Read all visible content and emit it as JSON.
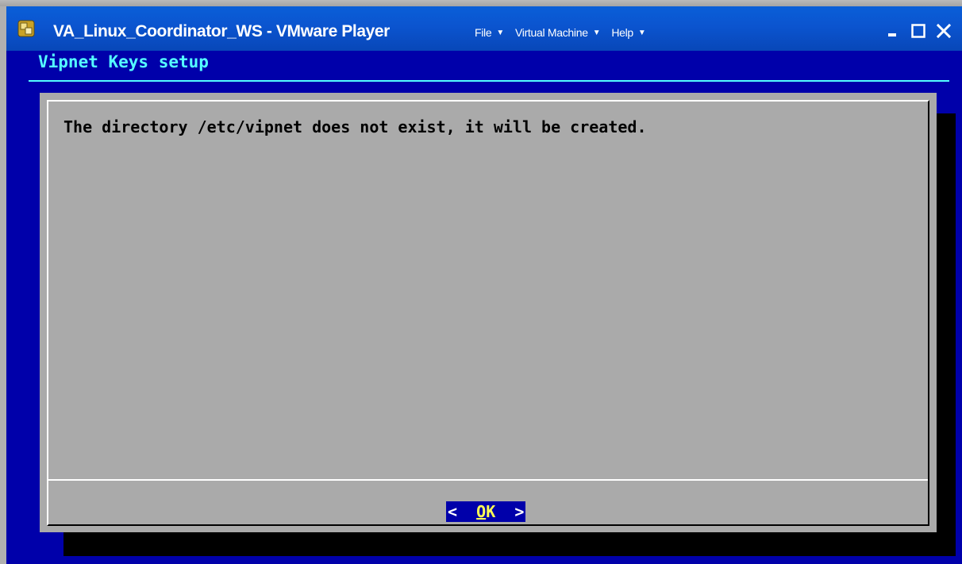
{
  "window": {
    "title": "VA_Linux_Coordinator_WS - VMware Player"
  },
  "menubar": {
    "items": [
      {
        "label": "File",
        "icon": "caret-down-icon"
      },
      {
        "label": "Virtual Machine",
        "icon": "caret-down-icon"
      },
      {
        "label": "Help",
        "icon": "caret-down-icon"
      }
    ]
  },
  "window_controls": {
    "minimize": "minimize-icon",
    "maximize": "maximize-icon",
    "close": "close-icon"
  },
  "screen": {
    "backtitle": "Vipnet Keys setup",
    "dialog": {
      "message": "The directory /etc/vipnet does not exist, it will be created.",
      "button": {
        "left_bracket": "<",
        "hotkey": "O",
        "rest": "K",
        "right_bracket": ">"
      }
    }
  },
  "colors": {
    "titlebar": "#0b54cf",
    "screen_background": "#0000aa",
    "backtitle": "#55ffff",
    "dialog_background": "#aaaaaa",
    "button_background": "#0000aa",
    "button_hotkey": "#ffff55",
    "button_text": "#ffffff"
  }
}
